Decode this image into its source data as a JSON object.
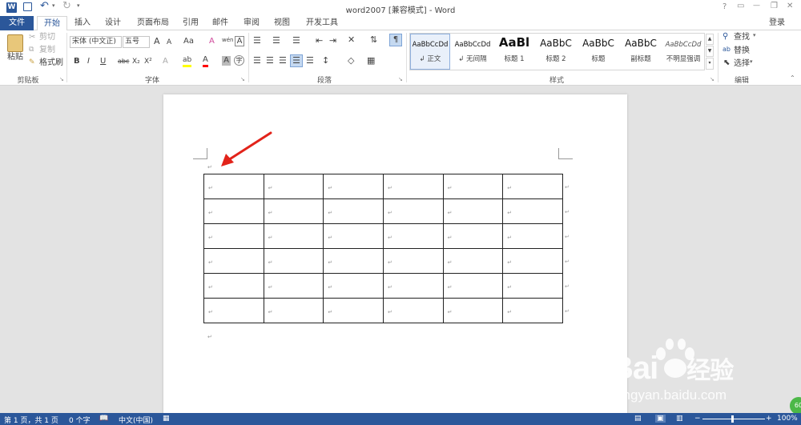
{
  "window": {
    "title": "word2007 [兼容模式] - Word",
    "help": "?",
    "restore": "▭",
    "minimize": "—",
    "maximize": "❐",
    "close": "✕"
  },
  "tabs": [
    {
      "label": "文件"
    },
    {
      "label": "开始"
    },
    {
      "label": "插入"
    },
    {
      "label": "设计"
    },
    {
      "label": "页面布局"
    },
    {
      "label": "引用"
    },
    {
      "label": "邮件"
    },
    {
      "label": "审阅"
    },
    {
      "label": "视图"
    },
    {
      "label": "开发工具"
    }
  ],
  "login": "登录",
  "clipboard": {
    "paste": "粘贴",
    "cut": "剪切",
    "copy": "复制",
    "format_painter": "格式刷",
    "label": "剪贴板"
  },
  "font": {
    "name": "宋体 (中文正)",
    "size": "五号",
    "label": "字体",
    "grow": "A",
    "shrink": "A",
    "case": "Aa",
    "clear": "A",
    "pinyin": "wén",
    "border": "A",
    "bold": "B",
    "italic": "I",
    "underline": "U",
    "strike": "abc",
    "sub": "X₂",
    "sup": "X²",
    "effects": "A",
    "highlight": "ab",
    "color": "A",
    "shade": "A",
    "enclose": "字"
  },
  "paragraph": {
    "label": "段落"
  },
  "styles": {
    "label": "样式",
    "items": [
      {
        "preview": "AaBbCcDd",
        "name": "↲ 正文"
      },
      {
        "preview": "AaBbCcDd",
        "name": "↲ 无间隔"
      },
      {
        "preview": "AaBl",
        "name": "标题 1"
      },
      {
        "preview": "AaBbC",
        "name": "标题 2"
      },
      {
        "preview": "AaBbC",
        "name": "标题"
      },
      {
        "preview": "AaBbC",
        "name": "副标题"
      },
      {
        "preview": "AaBbCcDd",
        "name": "不明显强调"
      }
    ]
  },
  "editing": {
    "find": "查找",
    "replace": "替换",
    "select": "选择",
    "label": "编辑"
  },
  "document": {
    "para_mark": "↵",
    "rows": 6,
    "cols": 6
  },
  "status": {
    "page": "第 1 页，共 1 页",
    "words": "0 个字",
    "lang": "中文(中国)",
    "zoom": "100%"
  },
  "watermark": {
    "brand": "Bai",
    "brand2": "经验",
    "url": "jingyan.baidu.com",
    "badge": "60"
  },
  "colors": {
    "accent": "#2b579a",
    "arrow": "#e2231a",
    "highlight": "#ffff00",
    "font_color": "#ff0000"
  }
}
